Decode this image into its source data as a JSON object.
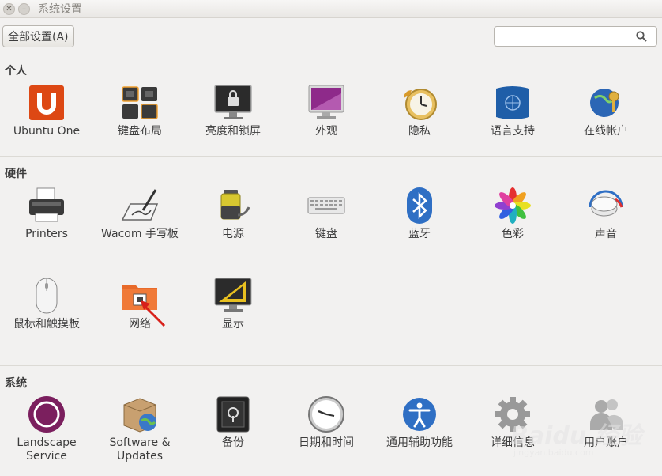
{
  "window": {
    "title": "系统设置"
  },
  "toolbar": {
    "all_settings_label": "全部设置(A)",
    "search_placeholder": ""
  },
  "sections": {
    "personal": {
      "title": "个人",
      "items": [
        "Ubuntu One",
        "键盘布局",
        "亮度和锁屏",
        "外观",
        "隐私",
        "语言支持",
        "在线帐户"
      ]
    },
    "hardware": {
      "title": "硬件",
      "items": [
        "Printers",
        "Wacom 手写板",
        "电源",
        "键盘",
        "蓝牙",
        "色彩",
        "声音",
        "鼠标和触摸板",
        "网络",
        "显示"
      ]
    },
    "system": {
      "title": "系统",
      "items": [
        "Landscape Service",
        "Software & Updates",
        "备份",
        "日期和时间",
        "通用辅助功能",
        "详细信息",
        "用户账户"
      ]
    }
  },
  "watermark": {
    "brand": "Baidu 经验",
    "url": "jingyan.baidu.com"
  },
  "icons": {
    "ubuntu_one": "ubuntu-one-icon",
    "keyboard_layout": "keyboard-layout-icon",
    "brightness_lock": "lock-screen-icon",
    "appearance": "appearance-icon",
    "privacy": "privacy-icon",
    "language": "language-icon",
    "online_accounts": "online-accounts-icon"
  },
  "colors": {
    "ubuntu_orange": "#dd4814",
    "bluetooth_blue": "#2f6fc4",
    "landscape_purple": "#7b1f5e"
  }
}
